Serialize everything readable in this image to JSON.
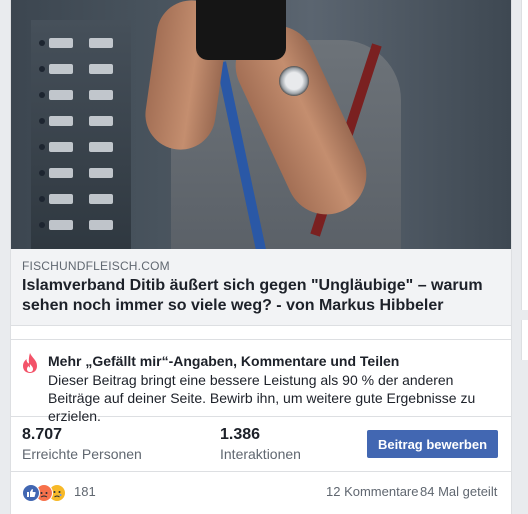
{
  "post": {
    "link": {
      "domain": "FISCHUNDFLEISCH.COM",
      "headline": "Islamverband Ditib äußert sich gegen \"Ungläubige\" – warum sehen noch immer so viele weg? - von Markus Hibbeler"
    },
    "boost": {
      "icon": "fire-icon",
      "title": "Mehr „Gefällt mir“-Angaben, Kommentare und Teilen",
      "text": "Dieser Beitrag bringt eine bessere Leistung als 90 % der anderen Beiträge auf deiner Seite. Bewirb ihn, um weitere gute Ergebnisse zu erzielen."
    },
    "stats": {
      "reach_value": "8.707",
      "reach_label": "Erreichte Personen",
      "interactions_value": "1.386",
      "interactions_label": "Interaktionen",
      "promote_label": "Beitrag bewerben"
    },
    "reactions": {
      "icons": [
        "like-icon",
        "angry-icon",
        "sad-icon"
      ],
      "count": "181",
      "comments": "12 Kommentare",
      "shares": "84 Mal geteilt"
    }
  },
  "colors": {
    "accent": "#4267b2",
    "fire": "#f35369",
    "angry": "#f7714b",
    "sad": "#f7b928",
    "link_bg": "#f2f3f5"
  }
}
